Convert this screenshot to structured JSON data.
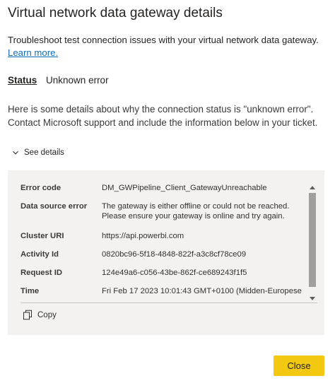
{
  "dialog": {
    "title": "Virtual network data gateway details",
    "description": "Troubleshoot test connection issues with your virtual network data gateway.",
    "learn_more": "Learn more.",
    "status_label": "Status",
    "status_value": "Unknown error",
    "explanation": "Here is some details about why the connection status is \"unknown error\". Contact Microsoft support and include the information below in your ticket.",
    "see_details": "See details",
    "details": [
      {
        "key": "Error code",
        "value": "DM_GWPipeline_Client_GatewayUnreachable"
      },
      {
        "key": "Data source error",
        "value": "The gateway is either offline or could not be reached. Please ensure your gateway is online and try again."
      },
      {
        "key": "Cluster URI",
        "value": "https://api.powerbi.com"
      },
      {
        "key": "Activity Id",
        "value": "0820bc96-5f18-4848-822f-a3c8cf78ce09"
      },
      {
        "key": "Request ID",
        "value": "124e49a6-c056-43be-862f-ce689243f1f5"
      },
      {
        "key": "Time",
        "value": "Fri Feb 17 2023 10:01:43 GMT+0100 (Midden-Europese"
      }
    ],
    "copy_label": "Copy",
    "close_label": "Close"
  },
  "colors": {
    "accent": "#f2c811",
    "link": "#0f6cbd",
    "panel_bg": "#f3f2f1"
  },
  "icons": {
    "expand": "chevron-down-icon",
    "copy": "copy-icon"
  }
}
